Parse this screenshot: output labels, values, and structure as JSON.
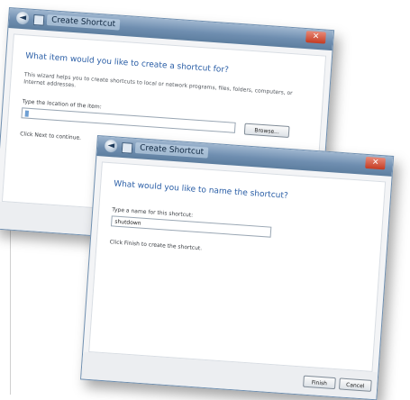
{
  "create_dialog": {
    "title": "Create Shortcut",
    "heading": "What item would you like to create a shortcut for?",
    "description": "This wizard helps you to create shortcuts to local or network programs, files, folders, computers, or Internet addresses.",
    "location_label": "Type the location of the item:",
    "location_value": "",
    "browse_label": "Browse...",
    "footer_text": "Click Next to continue."
  },
  "name_dialog": {
    "title": "Create Shortcut",
    "heading": "What would you like to name the shortcut?",
    "name_label": "Type a name for this shortcut:",
    "name_value": "shutdown",
    "footer_text": "Click Finish to create the shortcut.",
    "finish_label": "Finish",
    "cancel_label": "Cancel"
  }
}
